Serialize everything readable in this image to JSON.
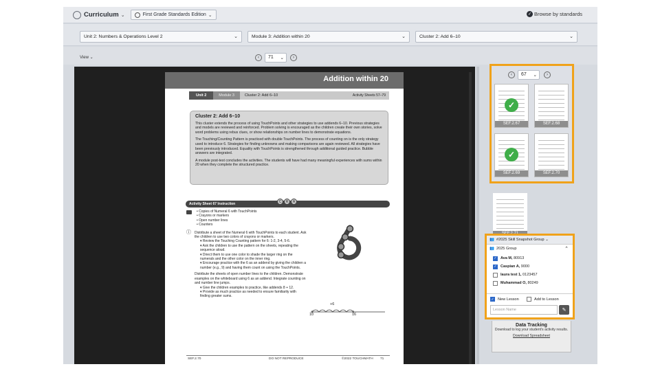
{
  "topbar": {
    "app_title": "Curriculum",
    "edition": "First Grade Standards Edition",
    "browse_label": "Browse by standards"
  },
  "selectors": {
    "unit": "Unit 2: Numbers & Operations Level 2",
    "module": "Module 3: Addition within 20",
    "cluster": "Cluster 2: Add 6–10"
  },
  "viewbar": {
    "view_label": "View",
    "page_value": "71"
  },
  "document": {
    "banner_title": "Addition within 20",
    "tab_unit": "Unit 2",
    "tab_module": "Module 3",
    "tab_cluster": "Cluster 2: Add 6–10",
    "tab_sheets": "Activity Sheets 57–79",
    "cluster_heading": "Cluster 2: Add 6–10",
    "cluster_p1": "This cluster extends the process of using TouchPoints and other strategies to use addends 6–10. Previous strategies and models are reviewed and reinforced. Problem solving is encouraged as the children create their own stories, solve word problems using rebus clues, or show relationships on number lines to demonstrate equations.",
    "cluster_p2": "The Touching/Counting Pattern is practiced with double TouchPoints. The process of counting on is the only strategy used to introduce 6. Strategies for finding unknowns and making comparisons are again reviewed. All strategies have been previously introduced. Equality with TouchPoints is strengthened through additional guided practice. Bubble answers are integrated.",
    "cluster_p3": "A module post-test concludes the activities. The students will have had many meaningful experiences with sums within 20 when they complete the structured practice.",
    "activity_heading": "Activity Sheet 67 Instruction",
    "cra": [
      "C",
      "R",
      "A"
    ],
    "materials": [
      "Copies of Numeral 6 with TouchPoints",
      "Crayons or markers",
      "Open number lines",
      "Counters"
    ],
    "instruction_1": "Distribute a sheet of the Numeral 6 with TouchPoints to each student. Ask the children to use two colors of crayons or markers.",
    "steps_1": [
      "Review the Touching Counting pattern for 6: 1-2, 3-4, 5-6.",
      "Ask the children to use the pattern on the sheets, repeating the sequence aloud.",
      "Direct them to use one color to shade the larger ring on the numerals and the other color on the inner ring.",
      "Encourage practice with the 6 as an addend by giving the children a number (e.g., 9) and having them count on using the TouchPoints."
    ],
    "instruction_2": "Distribute the sheets of open number lines to the children. Demonstrate examples on the whiteboard using 6 as an addend. Integrate counting on and number line jumps.",
    "steps_2": [
      "Give the children examples to practice, like addends 8 + 12.",
      "Provide as much practice as needed to ensure familiarity with finding greater sums."
    ],
    "numline_jump": "+6",
    "numline_start": "10",
    "numline_end": "16",
    "footer_left": "SEF.2.70",
    "footer_mid": "DO NOT REPRODUCE",
    "footer_right": "©2022 TOUCHMATH",
    "footer_page": "71"
  },
  "thumbnails": {
    "page_value": "67",
    "items": [
      {
        "label": "SEF.2.67",
        "done": true
      },
      {
        "label": "SEF.2.68",
        "done": false
      },
      {
        "label": "SEF.2.69",
        "done": true
      },
      {
        "label": "SEF.2.70",
        "done": false
      }
    ],
    "lone_label": "SEF.2.71"
  },
  "group_panel": {
    "snapshot_group": "#2025 Skill Snapshot Group",
    "group_name": "2025 Group",
    "members": [
      {
        "name": "Ava M,",
        "id": "80913",
        "checked": true
      },
      {
        "name": "Caspian A,",
        "id": "9000",
        "checked": true
      },
      {
        "name": "laura test 1,",
        "id": "0123457",
        "checked": false
      },
      {
        "name": "Muhammad O,",
        "id": "80249",
        "checked": false
      }
    ],
    "new_lesson_label": "New Lesson",
    "add_to_lesson_label": "Add to Lesson",
    "lesson_placeholder": "Lesson Name"
  },
  "data_tracking": {
    "title": "Data Tracking",
    "desc": "Download to log your student's activity results.",
    "link": "Download Spreadsheet"
  },
  "colors": {
    "highlight": "#f0a21a",
    "check_green": "#3fae49",
    "checkbox_blue": "#2b67c8"
  }
}
